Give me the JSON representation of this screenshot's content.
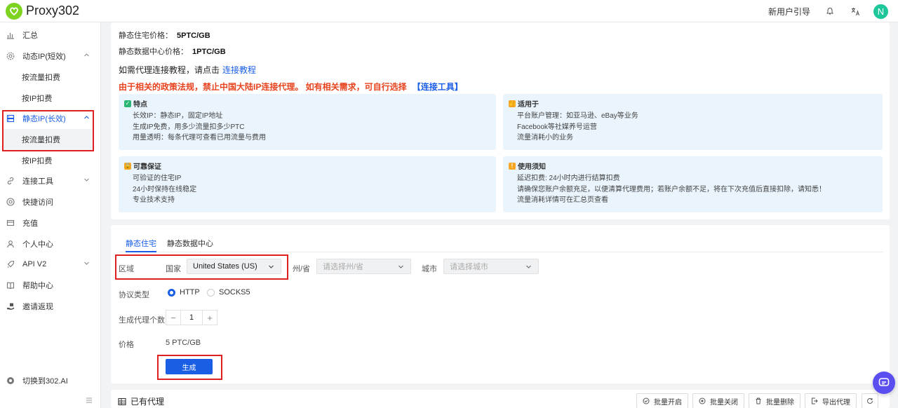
{
  "app": {
    "name": "Proxy302"
  },
  "header": {
    "guide_label": "新用户引导",
    "avatar_letter": "N"
  },
  "sidebar": {
    "items": [
      {
        "label": "汇总"
      },
      {
        "label": "动态IP(短效)"
      },
      {
        "label": "按流量扣费"
      },
      {
        "label": "按IP扣费"
      },
      {
        "label": "静态IP(长效)"
      },
      {
        "label": "按流量扣费"
      },
      {
        "label": "按IP扣费"
      },
      {
        "label": "连接工具"
      },
      {
        "label": "快捷访问"
      },
      {
        "label": "充值"
      },
      {
        "label": "个人中心"
      },
      {
        "label": "API V2"
      },
      {
        "label": "帮助中心"
      },
      {
        "label": "邀请返现"
      },
      {
        "label": "切换到302.AI"
      }
    ]
  },
  "pricing": {
    "residential_label": "静态住宅价格：",
    "residential_value": "5PTC/GB",
    "datacenter_label": "静态数据中心价格：",
    "datacenter_value": "1PTC/GB"
  },
  "tutorial": {
    "text": "如需代理连接教程，请点击",
    "link": "连接教程"
  },
  "warning": {
    "text": "由于相关的政策法规，禁止中国大陆IP连接代理。 如有相关需求，可自行选择",
    "link": "【连接工具】"
  },
  "features": {
    "title": "特点",
    "lines": [
      "长效IP：静态IP，固定IP地址",
      "生成IP免费，用多少流量扣多少PTC",
      "用量透明：每条代理可查看已用流量与费用"
    ]
  },
  "use_cases": {
    "title": "适用于",
    "lines": [
      "平台账户管理：如亚马逊、eBay等业务",
      "Facebook等社媒养号运营",
      "流量消耗小的业务"
    ]
  },
  "guarantee": {
    "title": "可靠保证",
    "lines": [
      "可验证的住宅IP",
      "24小时保持在线稳定",
      "专业技术支持"
    ]
  },
  "notice": {
    "title": "使用须知",
    "lines": [
      "延迟扣费: 24小时内进行结算扣费",
      "请确保您账户余额充足，以便清算代理费用；若账户余额不足，将在下次充值后直接扣除，请知悉！",
      "流量消耗详情可在汇总页查看"
    ]
  },
  "tabs": [
    {
      "label": "静态住宅"
    },
    {
      "label": "静态数据中心"
    }
  ],
  "form": {
    "region_label": "区域",
    "country_label": "国家",
    "country_value": "United States (US)",
    "state_label": "州/省",
    "state_placeholder": "请选择州/省",
    "city_label": "城市",
    "city_placeholder": "请选择城市",
    "protocol_label": "协议类型",
    "protocol_options": [
      "HTTP",
      "SOCKS5"
    ],
    "protocol_selected": "HTTP",
    "count_label": "生成代理个数",
    "count_value": "1",
    "price_label": "价格",
    "price_value": "5 PTC/GB",
    "generate_label": "生成"
  },
  "proxies": {
    "title": "已有代理",
    "buttons": [
      "批量开启",
      "批量关闭",
      "批量删除",
      "导出代理"
    ]
  },
  "colors": {
    "primary": "#1a5ee6",
    "warning": "#e8431f",
    "highlight_box": "#e02020",
    "info_bg": "#eaf4fc"
  }
}
